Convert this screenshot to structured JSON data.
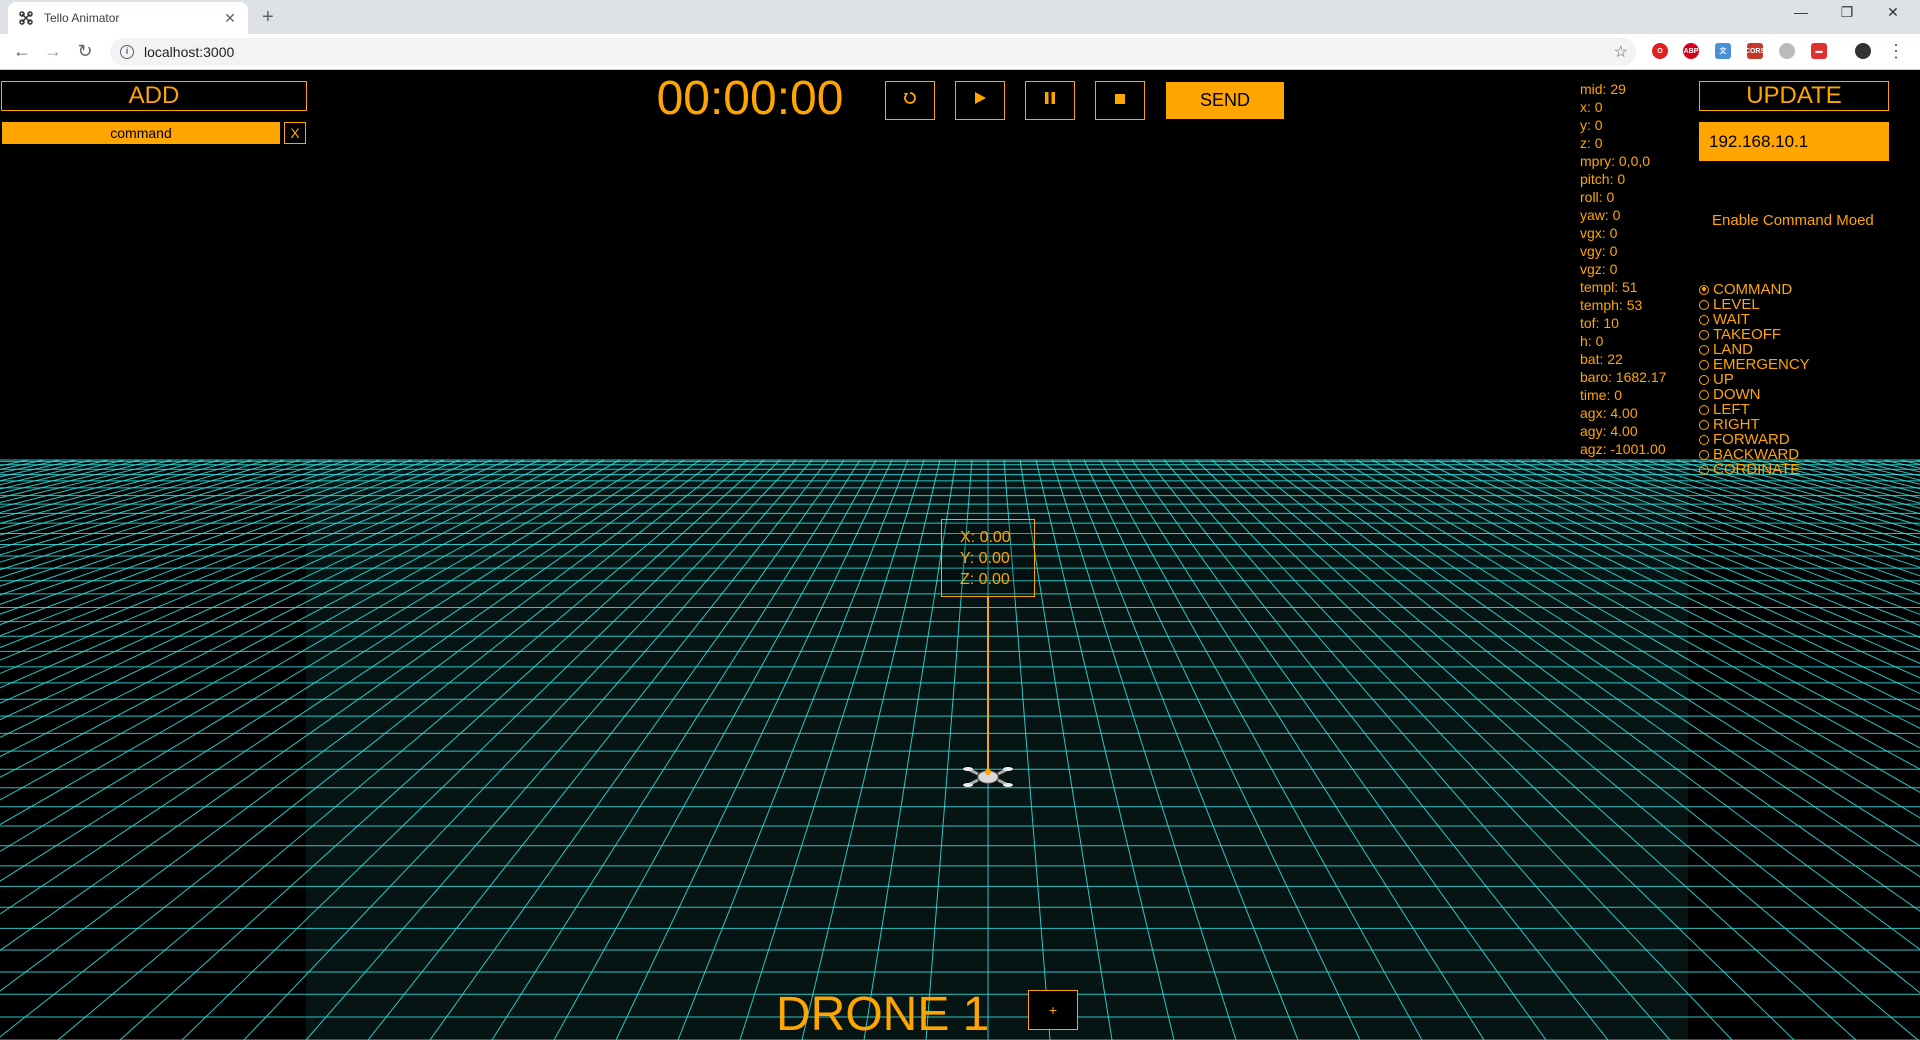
{
  "browser": {
    "tab_title": "Tello Animator",
    "tab_close": "✕",
    "new_tab": "+",
    "url": "localhost:3000",
    "window_controls": [
      "—",
      "❐",
      "✕"
    ]
  },
  "left_panel": {
    "add_label": "ADD",
    "command_value": "command",
    "remove_label": "X"
  },
  "timeline": {
    "timer": "00:00:00",
    "send_label": "SEND"
  },
  "telemetry": [
    "mid: 29",
    "x: 0",
    "y: 0",
    "z: 0",
    "mpry: 0,0,0",
    "pitch: 0",
    "roll: 0",
    "yaw: 0",
    "vgx: 0",
    "vgy: 0",
    "vgz: 0",
    "templ: 51",
    "temph: 53",
    "tof: 10",
    "h: 0",
    "bat: 22",
    "baro: 1682.17",
    "time: 0",
    "agx: 4.00",
    "agy: 4.00",
    "agz: -1001.00"
  ],
  "right_panel": {
    "update_label": "UPDATE",
    "ip_value": "192.168.10.1",
    "enable_label": "Enable Command Moed",
    "modes": [
      "COMMAND",
      "LEVEL",
      "WAIT",
      "TAKEOFF",
      "LAND",
      "EMERGENCY",
      "UP",
      "DOWN",
      "LEFT",
      "RIGHT",
      "FORWARD",
      "BACKWARD",
      "CORDINATE"
    ],
    "selected_mode": "COMMAND"
  },
  "scene": {
    "coord_x": "X: 0.00",
    "coord_y": "Y: 0.00",
    "coord_z": "Z: 0.00",
    "drone_label": "DRONE 1",
    "add_drone_label": "+",
    "grid_color": "#2ee6e6",
    "accent_color": "#ffa500"
  }
}
